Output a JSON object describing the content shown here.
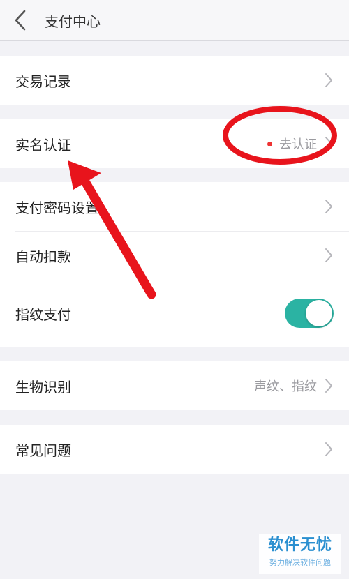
{
  "header": {
    "title": "支付中心"
  },
  "groups": {
    "records": {
      "label": "交易记录"
    },
    "realname": {
      "label": "实名认证",
      "status": "去认证",
      "dot_color": "#e33333"
    },
    "security": {
      "items": [
        {
          "label": "支付密码设置"
        },
        {
          "label": "自动扣款"
        },
        {
          "label": "指纹支付",
          "toggle_on": true
        }
      ]
    },
    "biometric": {
      "label": "生物识别",
      "value": "声纹、指纹"
    },
    "faq": {
      "label": "常见问题"
    }
  },
  "colors": {
    "toggle_on": "#2bb3a3",
    "annotation_red": "#e8141c",
    "background": "#f2f2f6"
  },
  "icons": {
    "back": "chevron-left-icon",
    "row_arrow": "chevron-right-icon"
  },
  "watermark": {
    "main": "软件无忧",
    "sub": "努力解决软件问题"
  }
}
